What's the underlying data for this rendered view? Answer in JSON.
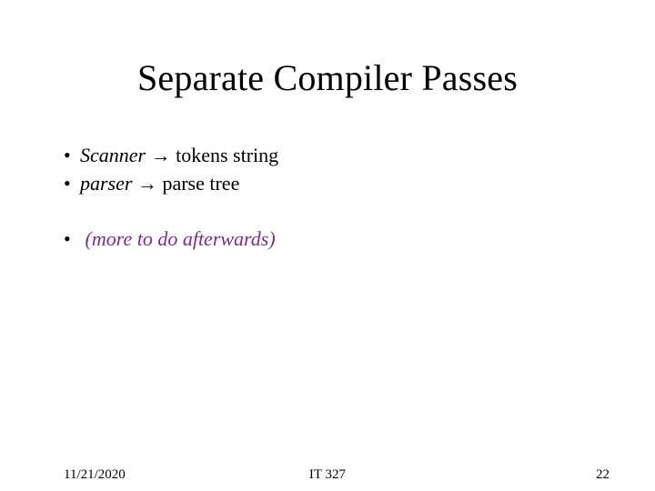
{
  "title": "Separate Compiler Passes",
  "bullets": [
    {
      "dot": "•",
      "term": "Scanner",
      "arrow": "→",
      "rest": "tokens string"
    },
    {
      "dot": "•",
      "term": "parser",
      "arrow": "→",
      "rest": "parse tree"
    }
  ],
  "more": {
    "dot": "•",
    "text": "(more to do afterwards)"
  },
  "footer": {
    "date": "11/21/2020",
    "course": "IT 327",
    "page": "22"
  }
}
